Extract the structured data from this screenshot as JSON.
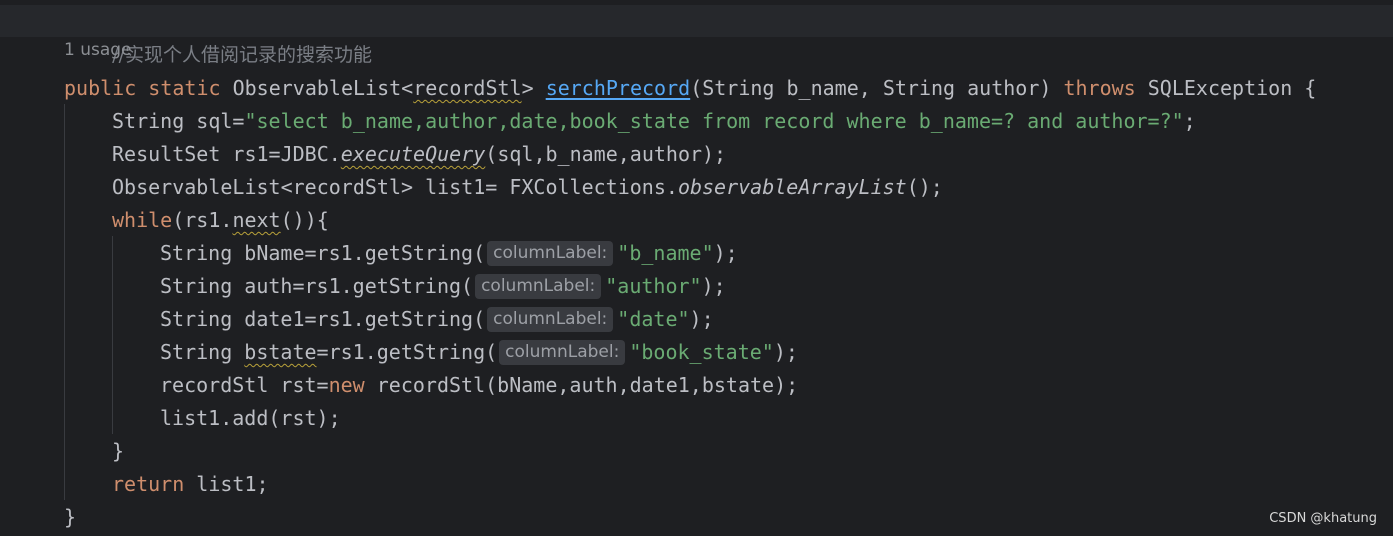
{
  "editor": {
    "comment": "//实现个人借阅记录的搜索功能",
    "usage_hint": "1 usage",
    "lines": {
      "l1": {
        "kw1": "public",
        "kw2": "static",
        "t1": "ObservableList<",
        "t2": "recordStl",
        "t3": ">",
        "fn": "serchPrecord",
        "t4": "(String b_name, String author)",
        "kw3": "throws",
        "t5": "SQLException {"
      },
      "l2": {
        "t1": "String sql=",
        "s1": "\"select b_name,author,date,book_state from record where b_name=? and author=?\"",
        "t2": ";"
      },
      "l3": {
        "t1": "ResultSet rs1=JDBC.",
        "i1": "executeQuery",
        "t2": "(sql,b_name,author);"
      },
      "l4": {
        "t1": "ObservableList<recordStl> list1= FXCollections.",
        "i1": "observableArrayList",
        "t2": "();"
      },
      "l5": {
        "kw": "while",
        "t1": "(rs1.",
        "t2": "next",
        "t3": "()){"
      },
      "l6": {
        "t1": "String bName=rs1.getString(",
        "hint": "columnLabel:",
        "s1": "\"b_name\"",
        "t2": ");"
      },
      "l7": {
        "t1": "String auth=rs1.getString(",
        "hint": "columnLabel:",
        "s1": "\"author\"",
        "t2": ");"
      },
      "l8": {
        "t1": "String date1=rs1.getString(",
        "hint": "columnLabel:",
        "s1": "\"date\"",
        "t2": ");"
      },
      "l9": {
        "t1": "String ",
        "t2": "bstate",
        "t3": "=rs1.getString(",
        "hint": "columnLabel:",
        "s1": "\"book_state\"",
        "t4": ");"
      },
      "l10": {
        "t1": "recordStl rst=",
        "kw": "new",
        "t2": " recordStl(bName,auth,date1,bstate);"
      },
      "l11": {
        "t1": "list1.add(rst);"
      },
      "l12": {
        "t1": "}"
      },
      "l13": {
        "kw": "return",
        "t1": " list1;"
      },
      "l14": {
        "t1": "}"
      }
    }
  },
  "watermark": "CSDN @khatung",
  "colors": {
    "background": "#1e1f22",
    "keyword": "#cf8e6d",
    "string": "#6aab73",
    "function_declaration": "#56a8f5",
    "comment": "#7a7e85",
    "default_text": "#bcbec4"
  }
}
